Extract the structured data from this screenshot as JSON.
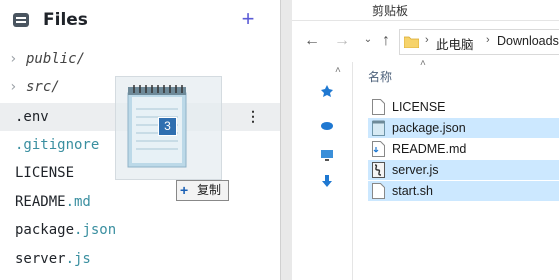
{
  "sidebar": {
    "title": "Files",
    "add_label": "+",
    "items": [
      {
        "type": "folder",
        "name": "public/"
      },
      {
        "type": "folder",
        "name": "src/"
      },
      {
        "type": "file",
        "base": ".env",
        "ext": ""
      },
      {
        "type": "file",
        "base": ".gitignore",
        "ext": ""
      },
      {
        "type": "file",
        "base": "LICENSE",
        "ext": ""
      },
      {
        "type": "file",
        "base": "README",
        "ext": ".md"
      },
      {
        "type": "file",
        "base": "package",
        "ext": ".json"
      },
      {
        "type": "file",
        "base": "server",
        "ext": ".js"
      }
    ],
    "row_menu": "⋮"
  },
  "drag": {
    "count": "3",
    "tooltip_plus": "+",
    "tooltip_label": "复制"
  },
  "explorer": {
    "title": "剪贴板",
    "breadcrumb": [
      "此电脑",
      "Downloads"
    ],
    "column_name": "名称",
    "files": [
      {
        "name": "LICENSE",
        "selected": false
      },
      {
        "name": "package.json",
        "selected": true
      },
      {
        "name": "README.md",
        "selected": false
      },
      {
        "name": "server.js",
        "selected": true
      },
      {
        "name": "start.sh",
        "selected": true
      }
    ]
  },
  "colors": {
    "accent": "#5b5bd6",
    "extension": "#3a8fa0",
    "selection": "#cce8ff"
  }
}
